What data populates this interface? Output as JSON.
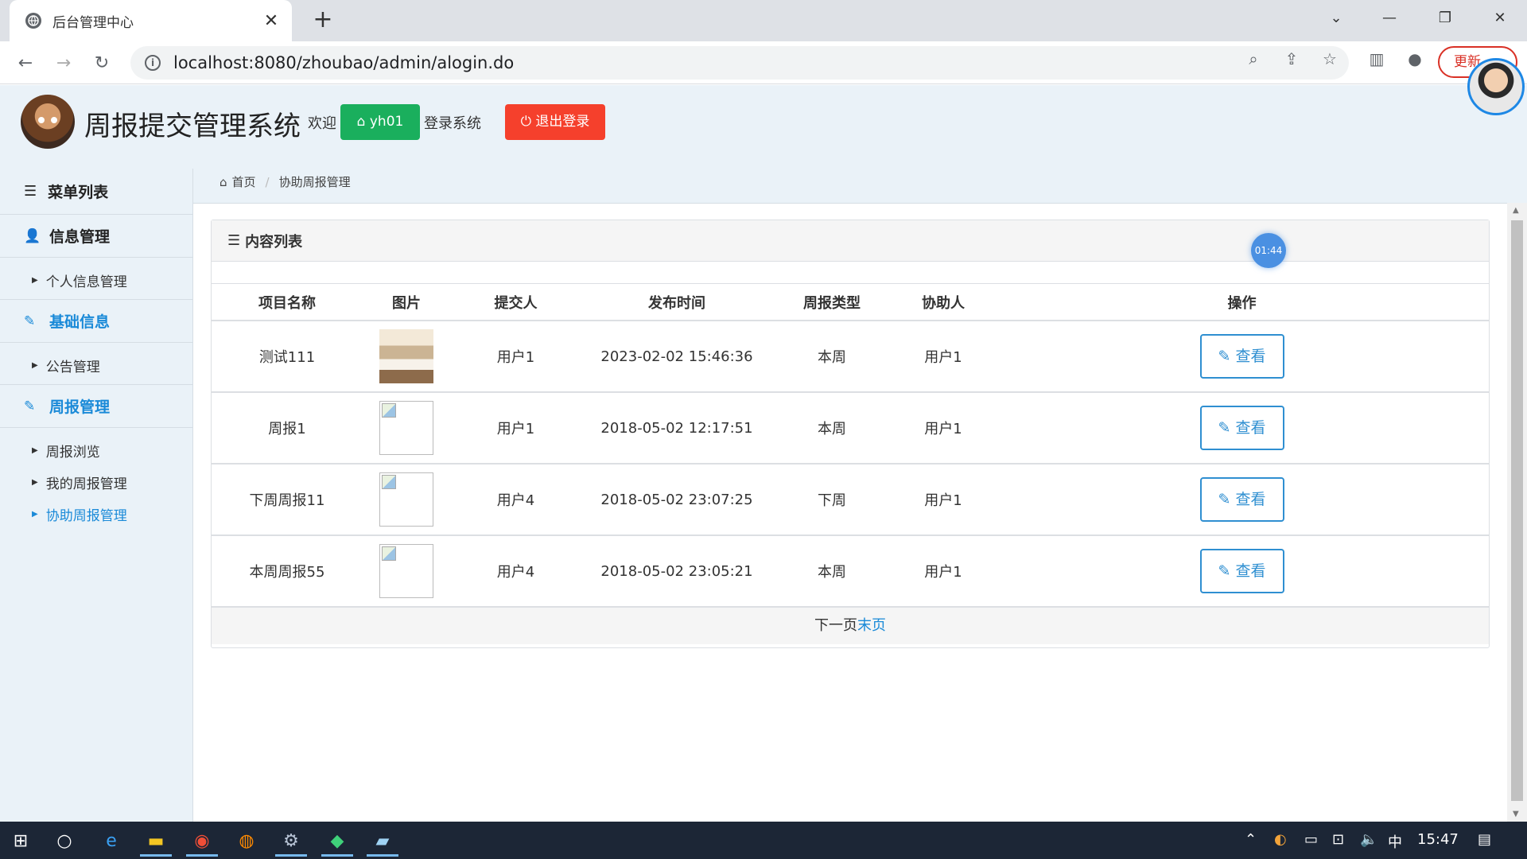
{
  "browser": {
    "tab_title": "后台管理中心",
    "url": "localhost:8080/zhoubao/admin/alogin.do",
    "update_label": "更新"
  },
  "header": {
    "system_title": "周报提交管理系统",
    "welcome": "欢迎",
    "username": "yh01",
    "login_text": "登录系统",
    "logout": "退出登录"
  },
  "sidebar": {
    "title": "菜单列表",
    "groups": [
      {
        "label": "信息管理",
        "items": [
          "个人信息管理"
        ]
      },
      {
        "label": "基础信息",
        "items": [
          "公告管理"
        ]
      },
      {
        "label": "周报管理",
        "items": [
          "周报浏览",
          "我的周报管理",
          "协助周报管理"
        ]
      }
    ]
  },
  "breadcrumb": {
    "home": "首页",
    "current": "协助周报管理"
  },
  "panel": {
    "title": "内容列表",
    "timer": "01:44",
    "columns": [
      "项目名称",
      "图片",
      "提交人",
      "发布时间",
      "周报类型",
      "协助人",
      "操作"
    ],
    "rows": [
      {
        "name": "测试111",
        "submitter": "用户1",
        "time": "2023-02-02 15:46:36",
        "type": "本周",
        "helper": "用户1",
        "action": "查看"
      },
      {
        "name": "周报1",
        "submitter": "用户1",
        "time": "2018-05-02 12:17:51",
        "type": "本周",
        "helper": "用户1",
        "action": "查看"
      },
      {
        "name": "下周周报11",
        "submitter": "用户4",
        "time": "2018-05-02 23:07:25",
        "type": "下周",
        "helper": "用户1",
        "action": "查看"
      },
      {
        "name": "本周周报55",
        "submitter": "用户4",
        "time": "2018-05-02 23:05:21",
        "type": "本周",
        "helper": "用户1",
        "action": "查看"
      }
    ],
    "pager_next": "下一页",
    "pager_last": "末页"
  },
  "taskbar": {
    "ime": "中",
    "clock": "15:47"
  }
}
